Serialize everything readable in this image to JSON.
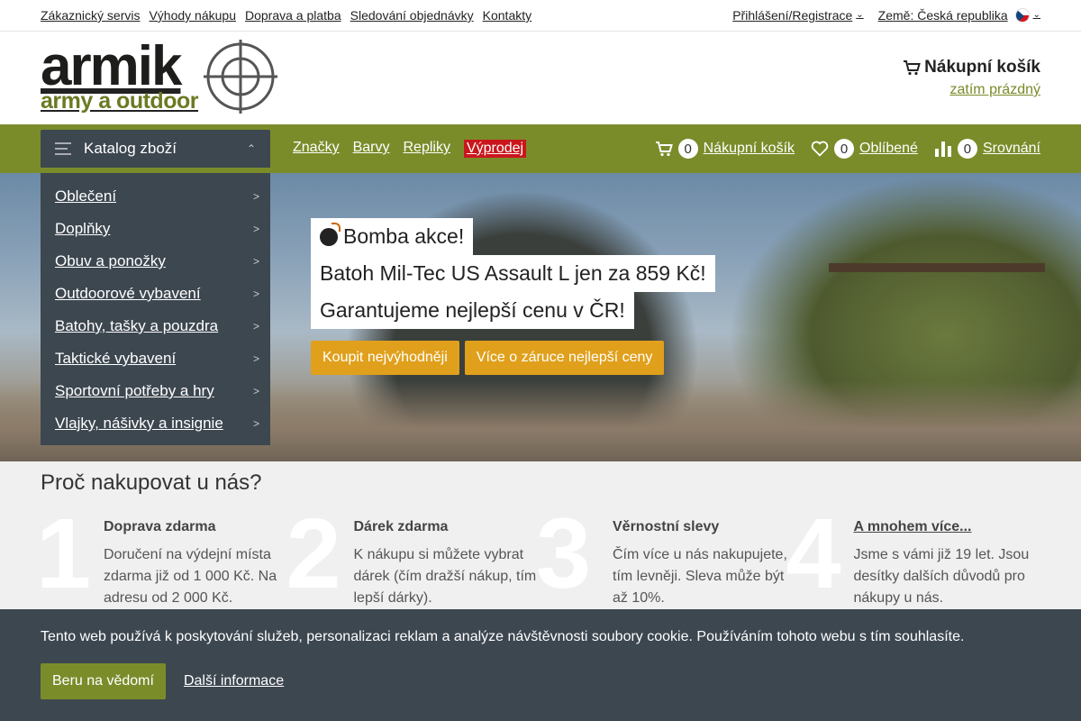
{
  "topbar": {
    "links": [
      "Zákaznický servis",
      "Výhody nákupu",
      "Doprava a platba",
      "Sledování objednávky",
      "Kontakty"
    ],
    "login": "Přihlášení/Registrace",
    "country": "Země: Česká republika"
  },
  "header": {
    "brand": "armik",
    "tagline": "army a outdoor",
    "cart_title": "Nákupní košík",
    "cart_status": "zatím prázdný"
  },
  "nav": {
    "catalog_label": "Katalog zboží",
    "links": [
      "Značky",
      "Barvy",
      "Repliky"
    ],
    "sale_label": "Výprodej",
    "cart_count": "0",
    "cart_label": "Nákupní košík",
    "fav_count": "0",
    "fav_label": "Oblíbené",
    "compare_count": "0",
    "compare_label": "Srovnání"
  },
  "categories": [
    "Oblečení",
    "Doplňky",
    "Obuv a ponožky",
    "Outdoorové vybavení",
    "Batohy, tašky a pouzdra",
    "Taktické vybavení",
    "Sportovní potřeby a hry",
    "Vlajky, nášivky a insignie"
  ],
  "promo": {
    "line1": "Bomba akce!",
    "line2": "Batoh Mil-Tec US Assault L jen za 859 Kč!",
    "line3": "Garantujeme nejlepší cenu v ČR!",
    "btn_buy": "Koupit nejvýhodněji",
    "btn_more": "Více o záruce nejlepší ceny"
  },
  "why": {
    "title": "Proč nakupovat u nás?",
    "reasons": [
      {
        "num": "1",
        "title": "Doprava zdarma",
        "text": "Doručení na výdejní místa zdarma již od 1 000 Kč. Na adresu od 2 000 Kč."
      },
      {
        "num": "2",
        "title": "Dárek zdarma",
        "text": "K nákupu si můžete vybrat dárek (čím dražší nákup, tím lepší dárky)."
      },
      {
        "num": "3",
        "title": "Věrnostní slevy",
        "text": "Čím více u nás nakupujete, tím levněji. Sleva může být až 10%."
      },
      {
        "num": "4",
        "title": "A mnohem více...",
        "text": "Jsme s vámi již 19 let. Jsou desítky dalších důvodů pro nákupy u nás."
      }
    ]
  },
  "cookie": {
    "message": "Tento web používá k poskytování služeb, personalizaci reklam a analýze návštěvnosti soubory cookie. Používáním tohoto webu s tím souhlasíte.",
    "accept": "Beru na vědomí",
    "more": "Další informace"
  },
  "colors": {
    "olive": "#7a8c2a",
    "slate": "#3d4750",
    "amber": "#e0a01c",
    "sale_red": "#c9161c"
  }
}
